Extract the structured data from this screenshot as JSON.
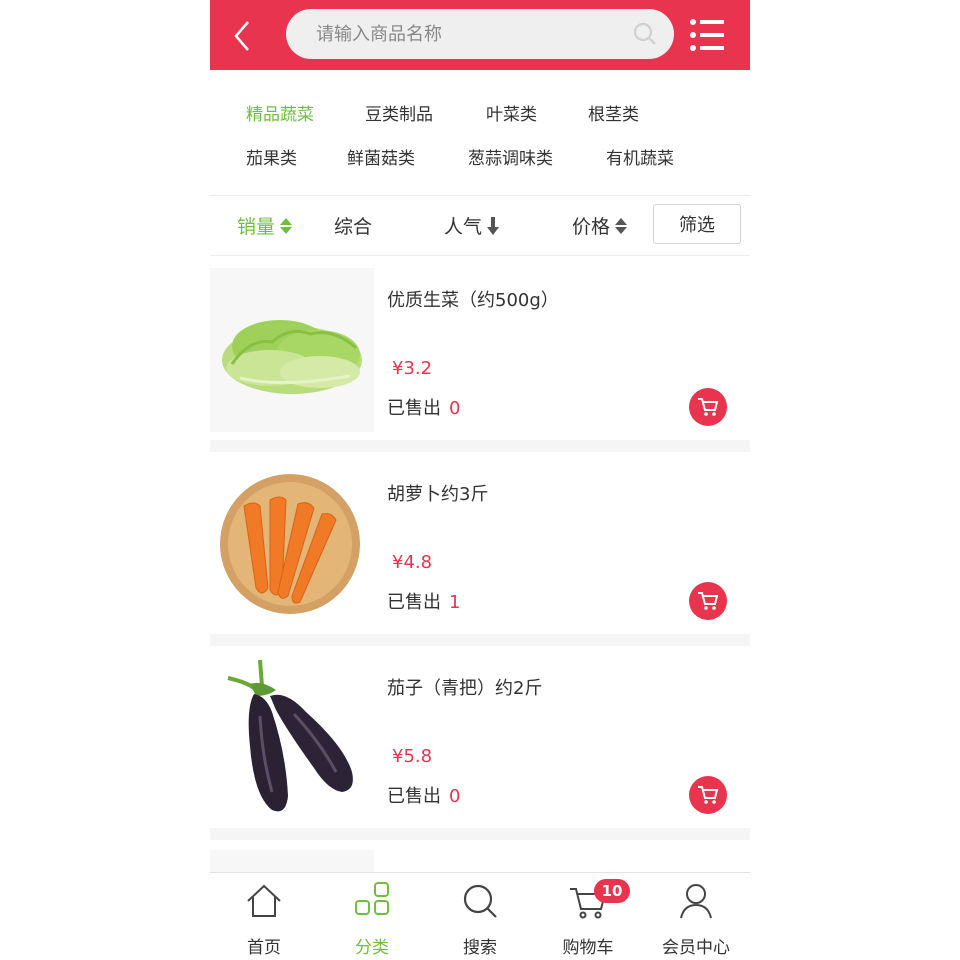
{
  "header": {
    "search_placeholder": "请输入商品名称",
    "icons": [
      "back-icon",
      "search-icon",
      "menu-list-icon"
    ]
  },
  "categories": [
    "精品蔬菜",
    "豆类制品",
    "叶菜类",
    "根茎类",
    "茄果类",
    "鲜菌菇类",
    "葱蒜调味类",
    "有机蔬菜"
  ],
  "active_category": "精品蔬菜",
  "sort": {
    "sales": "销量",
    "general": "综合",
    "popularity": "人气",
    "price": "价格",
    "filter": "筛选"
  },
  "products": [
    {
      "name": "优质生菜（约500g）",
      "price": "¥3.2",
      "sold_label": "已售出",
      "sold_count": "0"
    },
    {
      "name": "胡萝卜约3斤",
      "price": "¥4.8",
      "sold_label": "已售出",
      "sold_count": "1"
    },
    {
      "name": "茄子（青把）约2斤",
      "price": "¥5.8",
      "sold_label": "已售出",
      "sold_count": "0"
    }
  ],
  "tabbar": {
    "home": "首页",
    "category": "分类",
    "search": "搜索",
    "cart": "购物车",
    "member": "会员中心",
    "cart_badge": "10"
  },
  "colors": {
    "brand": "#e8344e",
    "active": "#6fbf3f",
    "text": "#333333"
  }
}
